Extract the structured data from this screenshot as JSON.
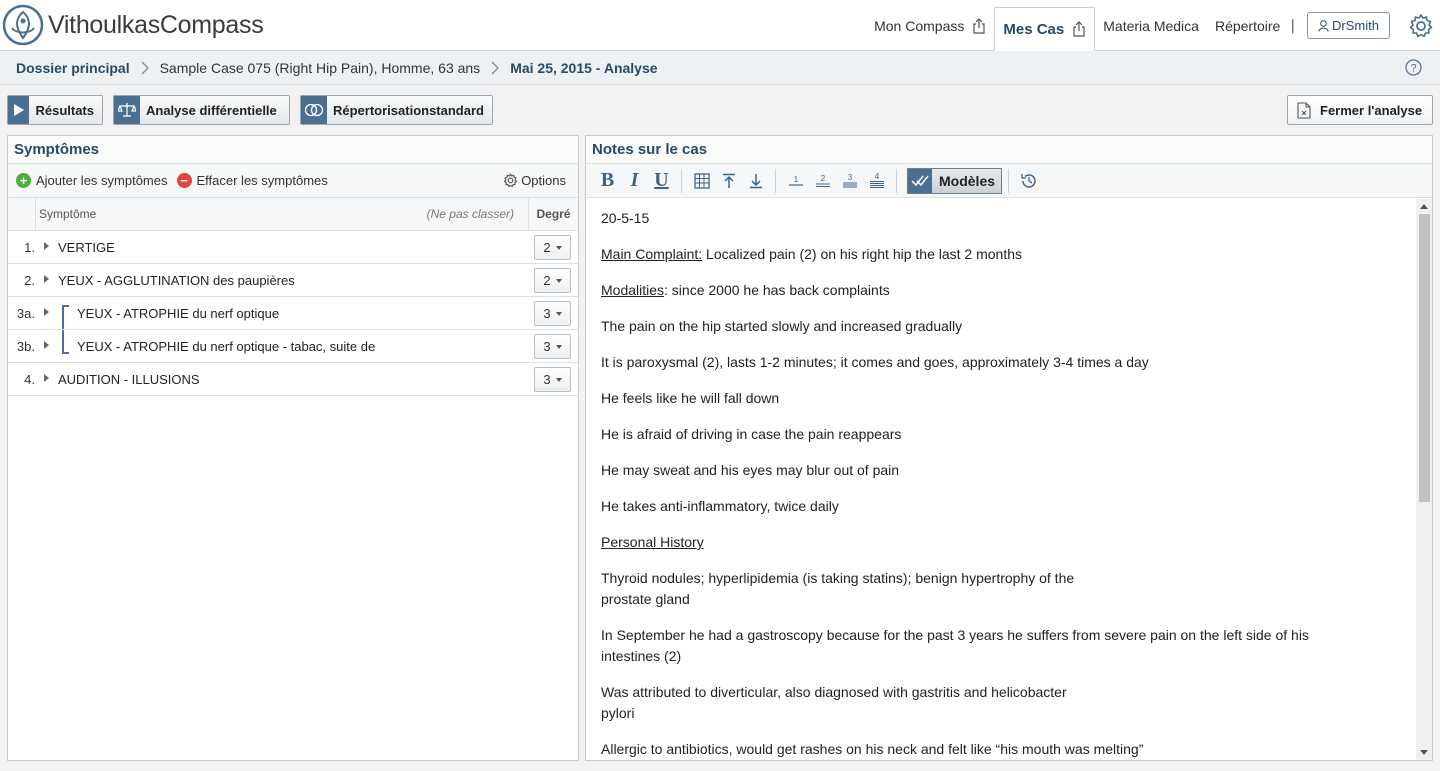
{
  "app": {
    "logo_light": "Vithoulkas",
    "logo_bold": "Compass"
  },
  "nav": {
    "items": [
      {
        "label": "Mon Compass"
      },
      {
        "label": "Mes Cas"
      },
      {
        "label": "Materia Medica"
      },
      {
        "label": "Répertoire"
      }
    ],
    "separator": "|",
    "user": "DrSmith"
  },
  "breadcrumb": {
    "root": "Dossier principal",
    "case": "Sample Case 075 (Right Hip Pain), Homme, 63 ans",
    "analysis": "Mai 25, 2015 - Analyse"
  },
  "toolbar": {
    "results": "Résultats",
    "differential": "Analyse différentielle",
    "standard": "Répertorisationstandard",
    "close": "Fermer l'analyse"
  },
  "symptoms": {
    "title": "Symptômes",
    "add": "Ajouter les symptômes",
    "clear": "Effacer les symptômes",
    "options": "Options",
    "col_symptom": "Symptôme",
    "col_noclass": "(Ne pas classer)",
    "col_degree": "Degré",
    "rows": [
      {
        "num": "1.",
        "text": "VERTIGE",
        "degree": "2"
      },
      {
        "num": "2.",
        "text": "YEUX - AGGLUTINATION des paupières",
        "degree": "2"
      },
      {
        "num": "3a.",
        "text": "YEUX - ATROPHIE du nerf optique",
        "degree": "3"
      },
      {
        "num": "3b.",
        "text": "YEUX - ATROPHIE du nerf optique - tabac, suite de",
        "degree": "3"
      },
      {
        "num": "4.",
        "text": "AUDITION - ILLUSIONS",
        "degree": "3"
      }
    ]
  },
  "notes": {
    "title": "Notes sur le cas",
    "modeles": "Modèles",
    "format_bold": "B",
    "format_italic": "I",
    "format_underline": "U",
    "heading_buttons": [
      "1",
      "2",
      "3",
      "4"
    ],
    "date": "20-5-15",
    "main_label": "Main Complaint:",
    "main_text": " Localized pain (2) on his right hip the last 2 months",
    "mod_label": "Modalities",
    "mod_text": ": since 2000 he has back complaints",
    "p1": "The pain on the hip started slowly and increased gradually",
    "p2": "It is paroxysmal (2), lasts 1-2 minutes; it comes and goes, approximately 3-4 times a day",
    "p3": "He feels like he will fall down",
    "p4": "He is afraid of driving in case the pain reappears",
    "p5": "He may sweat and his eyes may blur out of pain",
    "p6": "He takes anti-inflammatory, twice daily",
    "ph_label": "Personal History",
    "p7a": "Thyroid nodules; hyperlipidemia (is taking statins); benign hypertrophy of the",
    "p7b": "prostate gland",
    "p8a": "In September he had a gastroscopy because for the past 3 years he suffers from severe pain on the left side of his",
    "p8b": "intestines (2)",
    "p9a": "Was attributed to diverticular, also diagnosed with gastritis and helicobacter",
    "p9b": "pylori",
    "p10": "Allergic to antibiotics, would get rashes on his neck and felt like “his mouth was melting”"
  },
  "colors": {
    "accent": "#2a4a66",
    "button_icon": "#4a6f90",
    "add_green": "#4caf3c",
    "clear_red": "#e0453a"
  }
}
